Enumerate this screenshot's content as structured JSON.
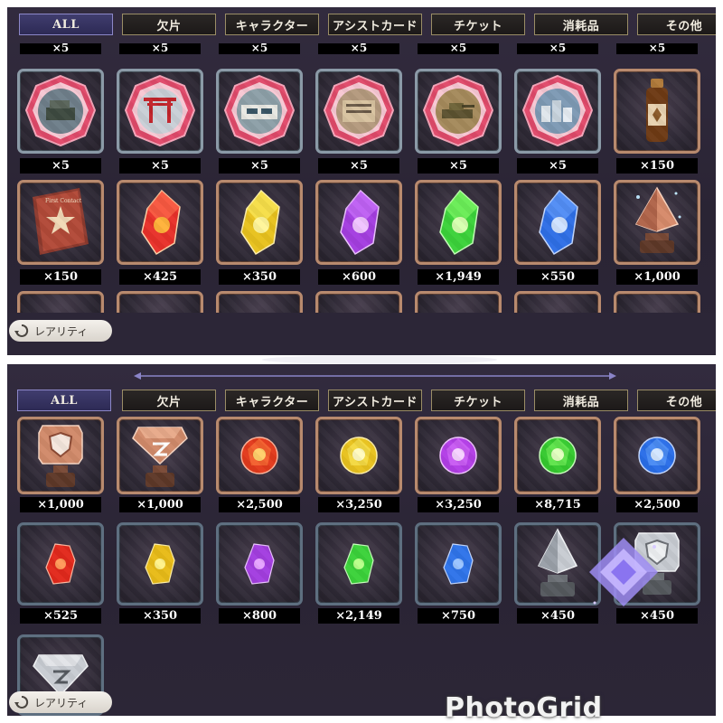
{
  "tabs": [
    "ALL",
    "欠片",
    "キャラクター",
    "アシストカード",
    "チケット",
    "消耗品",
    "その他"
  ],
  "active_tab": "ALL",
  "rarity_button": {
    "label": "レアリティ",
    "icon": "refresh-icon"
  },
  "top_panel": {
    "partial_row_counts": [
      "×5",
      "×5",
      "×5",
      "×5",
      "×5",
      "×5",
      "×5"
    ],
    "row1": [
      {
        "item": "stage-emblem-ruins",
        "count": "×5",
        "frame": "silver"
      },
      {
        "item": "stage-emblem-torii-gate",
        "count": "×5",
        "frame": "silver"
      },
      {
        "item": "stage-emblem-station",
        "count": "×5",
        "frame": "silver"
      },
      {
        "item": "stage-emblem-building",
        "count": "×5",
        "frame": "silver"
      },
      {
        "item": "stage-emblem-tank",
        "count": "×5",
        "frame": "silver"
      },
      {
        "item": "stage-emblem-city",
        "count": "×5",
        "frame": "silver"
      },
      {
        "item": "energy-drink-bottle",
        "count": "×150",
        "frame": "bronze"
      }
    ],
    "row2": [
      {
        "item": "red-book",
        "count": "×150",
        "frame": "bronze",
        "book_text": "First Contact"
      },
      {
        "item": "red-crystal-shard",
        "count": "×425",
        "frame": "bronze",
        "color": "#e8312a"
      },
      {
        "item": "yellow-crystal-shard",
        "count": "×350",
        "frame": "bronze",
        "color": "#e8c21e"
      },
      {
        "item": "purple-crystal-shard",
        "count": "×600",
        "frame": "bronze",
        "color": "#a43ee0"
      },
      {
        "item": "green-crystal-shard",
        "count": "×1,949",
        "frame": "bronze",
        "color": "#3bd23a"
      },
      {
        "item": "blue-crystal-shard",
        "count": "×550",
        "frame": "bronze",
        "color": "#2f6fe6"
      },
      {
        "item": "bronze-pyramid-trophy",
        "count": "×1,000",
        "frame": "bronze"
      }
    ]
  },
  "bottom_panel": {
    "row1": [
      {
        "item": "bronze-shield-trophy",
        "count": "×1,000",
        "frame": "bronze"
      },
      {
        "item": "bronze-gem-trophy",
        "count": "×1,000",
        "frame": "bronze"
      },
      {
        "item": "red-orb",
        "count": "×2,500",
        "frame": "bronze",
        "color": "#e23a1c"
      },
      {
        "item": "yellow-orb",
        "count": "×3,250",
        "frame": "bronze",
        "color": "#e8c21e"
      },
      {
        "item": "purple-orb",
        "count": "×3,250",
        "frame": "bronze",
        "color": "#b23ee6"
      },
      {
        "item": "green-orb",
        "count": "×8,715",
        "frame": "bronze",
        "color": "#35c92f"
      },
      {
        "item": "blue-orb",
        "count": "×2,500",
        "frame": "bronze",
        "color": "#2a6ee8"
      }
    ],
    "row2": [
      {
        "item": "red-small-crystal",
        "count": "×525",
        "frame": "steel",
        "color": "#e2291c"
      },
      {
        "item": "yellow-small-crystal",
        "count": "×350",
        "frame": "steel",
        "color": "#e8bb18"
      },
      {
        "item": "purple-small-crystal",
        "count": "×800",
        "frame": "steel",
        "color": "#a33ee0"
      },
      {
        "item": "green-small-crystal",
        "count": "×2,149",
        "frame": "steel",
        "color": "#3bd23a"
      },
      {
        "item": "blue-small-crystal",
        "count": "×750",
        "frame": "steel",
        "color": "#2f74ea"
      },
      {
        "item": "silver-pyramid-trophy",
        "count": "×450",
        "frame": "steel"
      },
      {
        "item": "silver-shield-trophy",
        "count": "×450",
        "frame": "steel"
      }
    ],
    "row3": [
      {
        "item": "silver-gem-trophy",
        "frame": "steel"
      }
    ]
  },
  "watermark": "PhotoGrid",
  "colors": {
    "panel_bg": "#2c2637",
    "tab_active": "#3a3768",
    "tab_border": "#9a8d66",
    "frame_bronze": "#b88a6e",
    "frame_steel": "#5e6f80"
  }
}
